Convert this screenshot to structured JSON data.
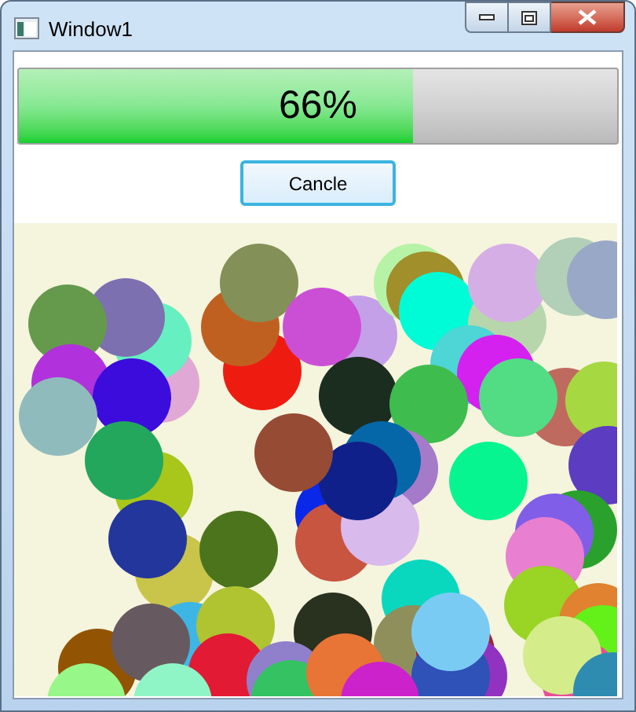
{
  "window": {
    "title": "Window1"
  },
  "progress": {
    "level": 0.66,
    "label": "66%"
  },
  "button": {
    "label": "Cancle"
  }
}
